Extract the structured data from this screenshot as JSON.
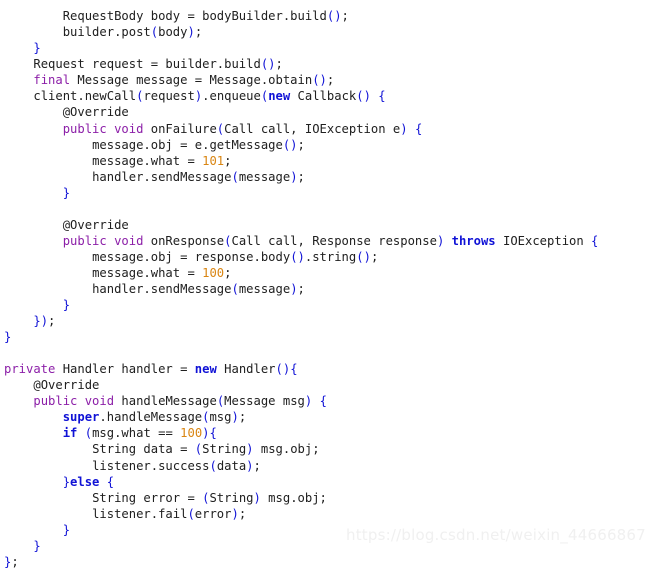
{
  "editor": {
    "language": "java",
    "background_color": "#ffffff",
    "default_text_color": "#202020",
    "keyword_purple_color": "#8c1fa8",
    "keyword_blue_color": "#1012d6",
    "number_color": "#d98512",
    "brace_color": "#1012d6"
  },
  "code": {
    "lines": [
      {
        "indent": 8,
        "segments": [
          {
            "t": "RequestBody body = bodyBuilder.build",
            "c": "plain"
          },
          {
            "t": "()",
            "c": "brace"
          },
          {
            "t": ";",
            "c": "plain"
          }
        ]
      },
      {
        "indent": 8,
        "segments": [
          {
            "t": "builder.post",
            "c": "plain"
          },
          {
            "t": "(",
            "c": "brace"
          },
          {
            "t": "body",
            "c": "plain"
          },
          {
            "t": ")",
            "c": "brace"
          },
          {
            "t": ";",
            "c": "plain"
          }
        ]
      },
      {
        "indent": 4,
        "segments": [
          {
            "t": "}",
            "c": "brace"
          }
        ]
      },
      {
        "indent": 4,
        "segments": [
          {
            "t": "Request request = builder.build",
            "c": "plain"
          },
          {
            "t": "()",
            "c": "brace"
          },
          {
            "t": ";",
            "c": "plain"
          }
        ]
      },
      {
        "indent": 4,
        "segments": [
          {
            "t": "final",
            "c": "kw-purple"
          },
          {
            "t": " Message message = Message.obtain",
            "c": "plain"
          },
          {
            "t": "()",
            "c": "brace"
          },
          {
            "t": ";",
            "c": "plain"
          }
        ]
      },
      {
        "indent": 4,
        "segments": [
          {
            "t": "client.newCall",
            "c": "plain"
          },
          {
            "t": "(",
            "c": "brace"
          },
          {
            "t": "request",
            "c": "plain"
          },
          {
            "t": ")",
            "c": "brace"
          },
          {
            "t": ".enqueue",
            "c": "plain"
          },
          {
            "t": "(",
            "c": "brace"
          },
          {
            "t": "new",
            "c": "kw-blue"
          },
          {
            "t": " Callback",
            "c": "plain"
          },
          {
            "t": "()",
            "c": "brace"
          },
          {
            "t": " ",
            "c": "plain"
          },
          {
            "t": "{",
            "c": "brace"
          }
        ]
      },
      {
        "indent": 8,
        "segments": [
          {
            "t": "@Override",
            "c": "plain"
          }
        ]
      },
      {
        "indent": 8,
        "segments": [
          {
            "t": "public void",
            "c": "kw-purple"
          },
          {
            "t": " onFailure",
            "c": "plain"
          },
          {
            "t": "(",
            "c": "brace"
          },
          {
            "t": "Call call, IOException e",
            "c": "plain"
          },
          {
            "t": ")",
            "c": "brace"
          },
          {
            "t": " ",
            "c": "plain"
          },
          {
            "t": "{",
            "c": "brace"
          }
        ]
      },
      {
        "indent": 12,
        "segments": [
          {
            "t": "message.obj = e.getMessage",
            "c": "plain"
          },
          {
            "t": "()",
            "c": "brace"
          },
          {
            "t": ";",
            "c": "plain"
          }
        ]
      },
      {
        "indent": 12,
        "segments": [
          {
            "t": "message.what = ",
            "c": "plain"
          },
          {
            "t": "101",
            "c": "num"
          },
          {
            "t": ";",
            "c": "plain"
          }
        ]
      },
      {
        "indent": 12,
        "segments": [
          {
            "t": "handler.sendMessage",
            "c": "plain"
          },
          {
            "t": "(",
            "c": "brace"
          },
          {
            "t": "message",
            "c": "plain"
          },
          {
            "t": ")",
            "c": "brace"
          },
          {
            "t": ";",
            "c": "plain"
          }
        ]
      },
      {
        "indent": 8,
        "segments": [
          {
            "t": "}",
            "c": "brace"
          }
        ]
      },
      {
        "indent": 0,
        "segments": []
      },
      {
        "indent": 8,
        "segments": [
          {
            "t": "@Override",
            "c": "plain"
          }
        ]
      },
      {
        "indent": 8,
        "segments": [
          {
            "t": "public void",
            "c": "kw-purple"
          },
          {
            "t": " onResponse",
            "c": "plain"
          },
          {
            "t": "(",
            "c": "brace"
          },
          {
            "t": "Call call, Response response",
            "c": "plain"
          },
          {
            "t": ")",
            "c": "brace"
          },
          {
            "t": " ",
            "c": "plain"
          },
          {
            "t": "throws",
            "c": "kw-blue"
          },
          {
            "t": " IOException ",
            "c": "plain"
          },
          {
            "t": "{",
            "c": "brace"
          }
        ]
      },
      {
        "indent": 12,
        "segments": [
          {
            "t": "message.obj = response.body",
            "c": "plain"
          },
          {
            "t": "()",
            "c": "brace"
          },
          {
            "t": ".string",
            "c": "plain"
          },
          {
            "t": "()",
            "c": "brace"
          },
          {
            "t": ";",
            "c": "plain"
          }
        ]
      },
      {
        "indent": 12,
        "segments": [
          {
            "t": "message.what = ",
            "c": "plain"
          },
          {
            "t": "100",
            "c": "num"
          },
          {
            "t": ";",
            "c": "plain"
          }
        ]
      },
      {
        "indent": 12,
        "segments": [
          {
            "t": "handler.sendMessage",
            "c": "plain"
          },
          {
            "t": "(",
            "c": "brace"
          },
          {
            "t": "message",
            "c": "plain"
          },
          {
            "t": ")",
            "c": "brace"
          },
          {
            "t": ";",
            "c": "plain"
          }
        ]
      },
      {
        "indent": 8,
        "segments": [
          {
            "t": "}",
            "c": "brace"
          }
        ]
      },
      {
        "indent": 4,
        "segments": [
          {
            "t": "})",
            "c": "brace"
          },
          {
            "t": ";",
            "c": "plain"
          }
        ]
      },
      {
        "indent": 0,
        "segments": [
          {
            "t": "}",
            "c": "brace"
          }
        ]
      },
      {
        "indent": 0,
        "segments": []
      },
      {
        "indent": 0,
        "segments": [
          {
            "t": "private",
            "c": "kw-purple"
          },
          {
            "t": " Handler handler = ",
            "c": "plain"
          },
          {
            "t": "new",
            "c": "kw-blue"
          },
          {
            "t": " Handler",
            "c": "plain"
          },
          {
            "t": "()",
            "c": "brace"
          },
          {
            "t": "{",
            "c": "brace"
          }
        ]
      },
      {
        "indent": 4,
        "segments": [
          {
            "t": "@Override",
            "c": "plain"
          }
        ]
      },
      {
        "indent": 4,
        "segments": [
          {
            "t": "public void",
            "c": "kw-purple"
          },
          {
            "t": " handleMessage",
            "c": "plain"
          },
          {
            "t": "(",
            "c": "brace"
          },
          {
            "t": "Message msg",
            "c": "plain"
          },
          {
            "t": ")",
            "c": "brace"
          },
          {
            "t": " ",
            "c": "plain"
          },
          {
            "t": "{",
            "c": "brace"
          }
        ]
      },
      {
        "indent": 8,
        "segments": [
          {
            "t": "super",
            "c": "kw-blue"
          },
          {
            "t": ".handleMessage",
            "c": "plain"
          },
          {
            "t": "(",
            "c": "brace"
          },
          {
            "t": "msg",
            "c": "plain"
          },
          {
            "t": ")",
            "c": "brace"
          },
          {
            "t": ";",
            "c": "plain"
          }
        ]
      },
      {
        "indent": 8,
        "segments": [
          {
            "t": "if",
            "c": "kw-blue"
          },
          {
            "t": " ",
            "c": "plain"
          },
          {
            "t": "(",
            "c": "brace"
          },
          {
            "t": "msg.what == ",
            "c": "plain"
          },
          {
            "t": "100",
            "c": "num"
          },
          {
            "t": ")",
            "c": "brace"
          },
          {
            "t": "{",
            "c": "brace"
          }
        ]
      },
      {
        "indent": 12,
        "segments": [
          {
            "t": "String data = ",
            "c": "plain"
          },
          {
            "t": "(",
            "c": "brace"
          },
          {
            "t": "String",
            "c": "plain"
          },
          {
            "t": ")",
            "c": "brace"
          },
          {
            "t": " msg.obj;",
            "c": "plain"
          }
        ]
      },
      {
        "indent": 12,
        "segments": [
          {
            "t": "listener.success",
            "c": "plain"
          },
          {
            "t": "(",
            "c": "brace"
          },
          {
            "t": "data",
            "c": "plain"
          },
          {
            "t": ")",
            "c": "brace"
          },
          {
            "t": ";",
            "c": "plain"
          }
        ]
      },
      {
        "indent": 8,
        "segments": [
          {
            "t": "}",
            "c": "brace"
          },
          {
            "t": "else",
            "c": "kw-blue"
          },
          {
            "t": " ",
            "c": "plain"
          },
          {
            "t": "{",
            "c": "brace"
          }
        ]
      },
      {
        "indent": 12,
        "segments": [
          {
            "t": "String error = ",
            "c": "plain"
          },
          {
            "t": "(",
            "c": "brace"
          },
          {
            "t": "String",
            "c": "plain"
          },
          {
            "t": ")",
            "c": "brace"
          },
          {
            "t": " msg.obj;",
            "c": "plain"
          }
        ]
      },
      {
        "indent": 12,
        "segments": [
          {
            "t": "listener.fail",
            "c": "plain"
          },
          {
            "t": "(",
            "c": "brace"
          },
          {
            "t": "error",
            "c": "plain"
          },
          {
            "t": ")",
            "c": "brace"
          },
          {
            "t": ";",
            "c": "plain"
          }
        ]
      },
      {
        "indent": 8,
        "segments": [
          {
            "t": "}",
            "c": "brace"
          }
        ]
      },
      {
        "indent": 4,
        "segments": [
          {
            "t": "}",
            "c": "brace"
          }
        ]
      },
      {
        "indent": 0,
        "segments": [
          {
            "t": "}",
            "c": "brace"
          },
          {
            "t": ";",
            "c": "plain"
          }
        ]
      }
    ]
  },
  "watermark": {
    "text": "https://blog.csdn.net/weixin_44666867",
    "color": "#f0f0f0"
  }
}
